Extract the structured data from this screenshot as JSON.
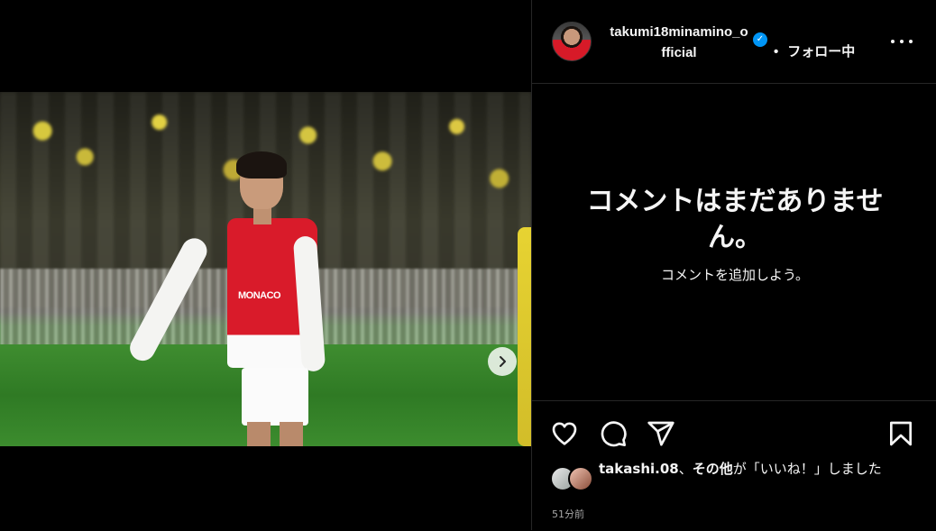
{
  "post": {
    "author": {
      "username": "takumi18minamino_official",
      "verified": true,
      "follow_status": "フォロー中"
    },
    "media": {
      "sponsor_text": "MONACO",
      "slide_count": 2,
      "active_slide": 1
    }
  },
  "comments": {
    "empty_title": "コメントはまだありません。",
    "empty_subtitle": "コメントを追加しよう。"
  },
  "likes": {
    "user": "takashi.08",
    "joiner": "、",
    "others": "その他",
    "suffix": "が「いいね！」しました"
  },
  "timestamp": "51分前",
  "icons": {
    "like": "heart-icon",
    "comment": "comment-icon",
    "share": "share-icon",
    "save": "bookmark-icon",
    "more": "more-icon",
    "next": "chevron-right-icon",
    "verified": "verified-badge-icon"
  },
  "colors": {
    "background": "#000000",
    "text": "#f5f5f5",
    "muted": "#a8a8a8",
    "divider": "#262626",
    "verified": "#0095f6"
  }
}
